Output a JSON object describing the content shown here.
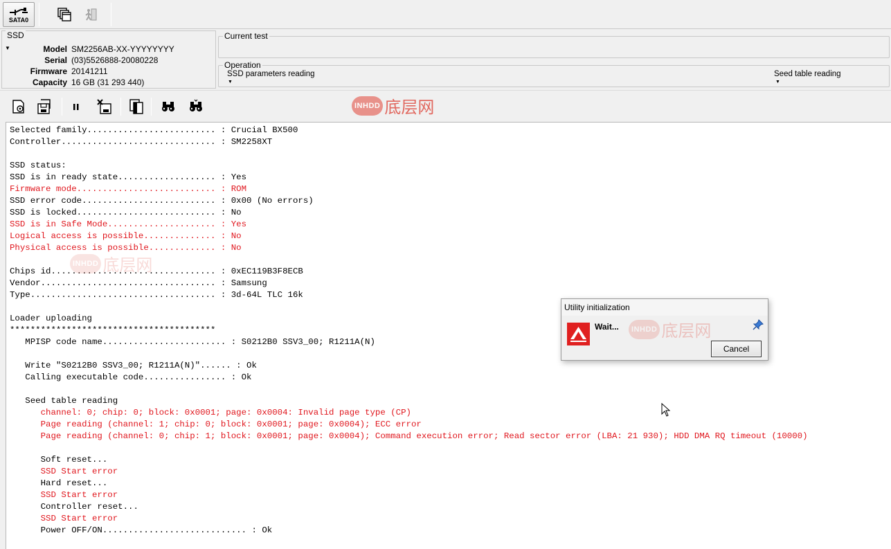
{
  "toolbar": {
    "sata_label": "SATA0"
  },
  "ssd": {
    "legend": "SSD",
    "rows": [
      {
        "key": "Model",
        "value": "SM2256AB-XX-YYYYYYYY"
      },
      {
        "key": "Serial",
        "value": "(03)5526888-20080228"
      },
      {
        "key": "Firmware",
        "value": "20141211"
      },
      {
        "key": "Capacity",
        "value": "16 GB (31 293 440)"
      }
    ]
  },
  "current_test": {
    "legend": "Current test"
  },
  "operation": {
    "legend": "Operation",
    "left": "SSD parameters reading",
    "right": "Seed table reading"
  },
  "watermark": {
    "badge": "INHDD",
    "text": "底层网"
  },
  "log": {
    "lines": [
      {
        "text": "Selected family......................... : Crucial BX500",
        "red": false
      },
      {
        "text": "Controller.............................. : SM2258XT",
        "red": false
      },
      {
        "text": "",
        "red": false
      },
      {
        "text": "SSD status:",
        "red": false
      },
      {
        "text": "SSD is in ready state................... : Yes",
        "red": false
      },
      {
        "text": "Firmware mode........................... : ROM",
        "red": true
      },
      {
        "text": "SSD error code.......................... : 0x00 (No errors)",
        "red": false
      },
      {
        "text": "SSD is locked........................... : No",
        "red": false
      },
      {
        "text": "SSD is in Safe Mode..................... : Yes",
        "red": true
      },
      {
        "text": "Logical access is possible.............. : No",
        "red": true
      },
      {
        "text": "Physical access is possible............. : No",
        "red": true
      },
      {
        "text": "",
        "red": false
      },
      {
        "text": "Chips id................................ : 0xEC119B3F8ECB",
        "red": false
      },
      {
        "text": "Vendor.................................. : Samsung",
        "red": false
      },
      {
        "text": "Type.................................... : 3d-64L TLC 16k",
        "red": false
      },
      {
        "text": "",
        "red": false
      },
      {
        "text": "Loader uploading",
        "red": false
      },
      {
        "text": "****************************************",
        "red": false
      },
      {
        "text": "   MPISP code name........................ : S0212B0 SSV3_00; R1211A(N)",
        "red": false
      },
      {
        "text": "",
        "red": false
      },
      {
        "text": "   Write \"S0212B0 SSV3_00; R1211A(N)\"...... : Ok",
        "red": false
      },
      {
        "text": "   Calling executable code................ : Ok",
        "red": false
      },
      {
        "text": "",
        "red": false
      },
      {
        "text": "   Seed table reading",
        "red": false
      },
      {
        "text": "      channel: 0; chip: 0; block: 0x0001; page: 0x0004: Invalid page type (CP)",
        "red": true
      },
      {
        "text": "      Page reading (channel: 1; chip: 0; block: 0x0001; page: 0x0004); ECC error",
        "red": true
      },
      {
        "text": "      Page reading (channel: 0; chip: 1; block: 0x0001; page: 0x0004); Command execution error; Read sector error (LBA: 21 930); HDD DMA RQ timeout (10000)",
        "red": true
      },
      {
        "text": "",
        "red": false
      },
      {
        "text": "      Soft reset...",
        "red": false
      },
      {
        "text": "      SSD Start error",
        "red": true
      },
      {
        "text": "      Hard reset...",
        "red": false
      },
      {
        "text": "      SSD Start error",
        "red": true
      },
      {
        "text": "      Controller reset...",
        "red": false
      },
      {
        "text": "      SSD Start error",
        "red": true
      },
      {
        "text": "      Power OFF/ON............................ : Ok",
        "red": false
      }
    ]
  },
  "dialog": {
    "title": "Utility initialization",
    "message": "Wait...",
    "cancel_label": "Cancel"
  },
  "colors": {
    "error_text": "#e0161d",
    "watermark": "#e05a50"
  }
}
